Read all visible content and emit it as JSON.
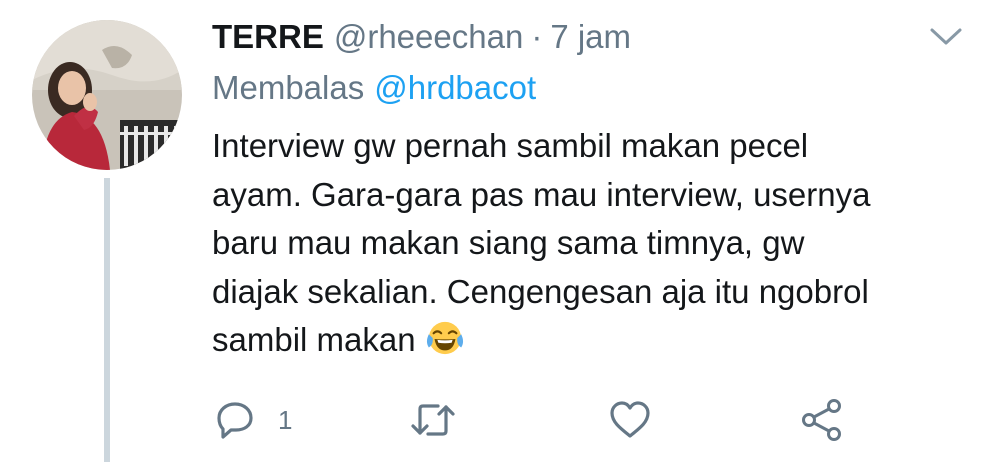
{
  "tweet": {
    "display_name": "TERRE",
    "handle": "@rheeechan",
    "separator": "·",
    "time": "7 jam",
    "reply_label": "Membalas",
    "reply_mention": "@hrdbacot",
    "text_lines": [
      "Interview gw pernah sambil makan pecel",
      "ayam. Gara-gara pas mau interview, usernya",
      "baru mau makan siang sama timnya, gw",
      "diajak sekalian. Cengengesan aja itu ngobrol",
      "sambil makan"
    ],
    "emoji": "face-with-tears-of-joy"
  },
  "actions": {
    "reply": {
      "icon": "reply-icon",
      "count": "1"
    },
    "retweet": {
      "icon": "retweet-icon"
    },
    "like": {
      "icon": "heart-icon"
    },
    "share": {
      "icon": "share-icon"
    }
  },
  "colors": {
    "text_primary": "#14171a",
    "text_secondary": "#657786",
    "link": "#1da1f2",
    "icon": "#657786",
    "thread_line": "#ccd6dd"
  }
}
